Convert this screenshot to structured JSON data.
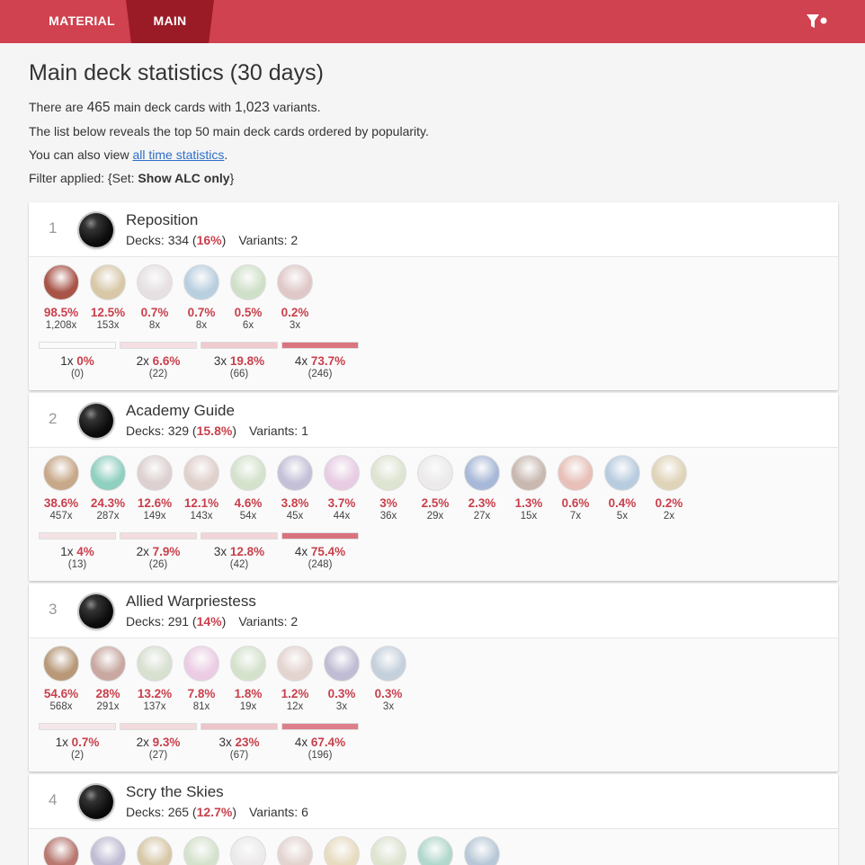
{
  "nav": {
    "tabs": [
      "MATERIAL",
      "MAIN"
    ]
  },
  "header": {
    "title": "Main deck statistics (30 days)",
    "line1_pre": "There are ",
    "card_count": "465",
    "line1_mid": " main deck cards with ",
    "variant_count": "1,023",
    "line1_post": " variants.",
    "line2": "The list below reveals the top 50 main deck cards ordered by popularity.",
    "line3_pre": "You can also view ",
    "line3_link": "all time statistics",
    "line3_post": ".",
    "filter_pre": "Filter applied: {Set: ",
    "filter_value": "Show ALC only",
    "filter_post": "}"
  },
  "labels": {
    "decks": "Decks: ",
    "variants": "Variants: "
  },
  "cards": [
    {
      "rank": "1",
      "name": "Reposition",
      "decks": "334",
      "deck_pct": "16%",
      "variants": "2",
      "avatars": [
        {
          "pct": "98.5%",
          "count": "1,208x",
          "color": "#a85548"
        },
        {
          "pct": "12.5%",
          "count": "153x",
          "color": "#d8c8a8"
        },
        {
          "pct": "0.7%",
          "count": "8x",
          "color": "#e6e0e2"
        },
        {
          "pct": "0.7%",
          "count": "8x",
          "color": "#b8cfe0"
        },
        {
          "pct": "0.5%",
          "count": "6x",
          "color": "#cfe0c8"
        },
        {
          "pct": "0.2%",
          "count": "3x",
          "color": "#e0c8c8"
        }
      ],
      "copies": [
        {
          "label": "1x",
          "pct": "0%",
          "count": "(0)",
          "fill": 0
        },
        {
          "label": "2x",
          "pct": "6.6%",
          "count": "(22)",
          "fill": 0.066
        },
        {
          "label": "3x",
          "pct": "19.8%",
          "count": "(66)",
          "fill": 0.198
        },
        {
          "label": "4x",
          "pct": "73.7%",
          "count": "(246)",
          "fill": 0.737
        }
      ]
    },
    {
      "rank": "2",
      "name": "Academy Guide",
      "decks": "329",
      "deck_pct": "15.8%",
      "variants": "1",
      "avatars": [
        {
          "pct": "38.6%",
          "count": "457x",
          "color": "#c7a888"
        },
        {
          "pct": "24.3%",
          "count": "287x",
          "color": "#8fd0c0"
        },
        {
          "pct": "12.6%",
          "count": "149x",
          "color": "#ddd0d0"
        },
        {
          "pct": "12.1%",
          "count": "143x",
          "color": "#e0d0cc"
        },
        {
          "pct": "4.6%",
          "count": "54x",
          "color": "#d4e2cc"
        },
        {
          "pct": "3.8%",
          "count": "45x",
          "color": "#c4c0d8"
        },
        {
          "pct": "3.7%",
          "count": "44x",
          "color": "#e8cce4"
        },
        {
          "pct": "3%",
          "count": "36x",
          "color": "#dde4d0"
        },
        {
          "pct": "2.5%",
          "count": "29x",
          "color": "#eceaea"
        },
        {
          "pct": "2.3%",
          "count": "27x",
          "color": "#a8b8d8"
        },
        {
          "pct": "1.3%",
          "count": "15x",
          "color": "#c8b8b0"
        },
        {
          "pct": "0.6%",
          "count": "7x",
          "color": "#e8c0b8"
        },
        {
          "pct": "0.4%",
          "count": "5x",
          "color": "#b8cce0"
        },
        {
          "pct": "0.2%",
          "count": "2x",
          "color": "#e0d4b8"
        }
      ],
      "copies": [
        {
          "label": "1x",
          "pct": "4%",
          "count": "(13)",
          "fill": 0.04
        },
        {
          "label": "2x",
          "pct": "7.9%",
          "count": "(26)",
          "fill": 0.079
        },
        {
          "label": "3x",
          "pct": "12.8%",
          "count": "(42)",
          "fill": 0.128
        },
        {
          "label": "4x",
          "pct": "75.4%",
          "count": "(248)",
          "fill": 0.754
        }
      ]
    },
    {
      "rank": "3",
      "name": "Allied Warpriestess",
      "decks": "291",
      "deck_pct": "14%",
      "variants": "2",
      "avatars": [
        {
          "pct": "54.6%",
          "count": "568x",
          "color": "#b89878"
        },
        {
          "pct": "28%",
          "count": "291x",
          "color": "#c8a8a0"
        },
        {
          "pct": "13.2%",
          "count": "137x",
          "color": "#d8e0d0"
        },
        {
          "pct": "7.8%",
          "count": "81x",
          "color": "#eccce4"
        },
        {
          "pct": "1.8%",
          "count": "19x",
          "color": "#d4e2cc"
        },
        {
          "pct": "1.2%",
          "count": "12x",
          "color": "#e4d4d0"
        },
        {
          "pct": "0.3%",
          "count": "3x",
          "color": "#c0bcd4"
        },
        {
          "pct": "0.3%",
          "count": "3x",
          "color": "#c4d0dc"
        }
      ],
      "copies": [
        {
          "label": "1x",
          "pct": "0.7%",
          "count": "(2)",
          "fill": 0.007
        },
        {
          "label": "2x",
          "pct": "9.3%",
          "count": "(27)",
          "fill": 0.093
        },
        {
          "label": "3x",
          "pct": "23%",
          "count": "(67)",
          "fill": 0.23
        },
        {
          "label": "4x",
          "pct": "67.4%",
          "count": "(196)",
          "fill": 0.674
        }
      ]
    },
    {
      "rank": "4",
      "name": "Scry the Skies",
      "decks": "265",
      "deck_pct": "12.7%",
      "variants": "6",
      "avatars": [
        {
          "color": "#b87870"
        },
        {
          "color": "#c0bcd4"
        },
        {
          "color": "#d8c8a8"
        },
        {
          "color": "#d4e2cc"
        },
        {
          "color": "#eceaea"
        },
        {
          "color": "#e4d4d0"
        },
        {
          "color": "#e8dcc0"
        },
        {
          "color": "#dde4d0"
        },
        {
          "color": "#b0d8cc"
        },
        {
          "color": "#b8c8d8"
        }
      ],
      "copies": []
    }
  ],
  "colors": {
    "accent": "#d0424f",
    "accent_dark": "#9a1b26",
    "pct_red": "#c9404c",
    "bar_full": "#d9707d"
  }
}
